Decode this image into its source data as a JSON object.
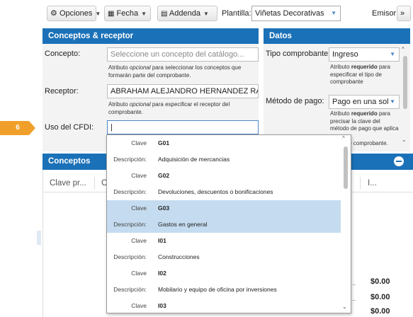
{
  "toolbar": {
    "opciones": "Opciones",
    "fecha": "Fecha",
    "addenda": "Addenda",
    "plantilla_label": "Plantilla:",
    "plantilla_value": "Viñetas Decorativas",
    "emisor": "Emisor",
    "more": "»"
  },
  "conceptos_receptor": {
    "title": "Conceptos & receptor",
    "concepto_label": "Concepto:",
    "concepto_placeholder": "Seleccione un concepto del catálogo...",
    "concepto_help_a": "Atributo",
    "concepto_help_em": "opcional",
    "concepto_help_b": "para seleccionar los conceptos que formarán parte del comprobante.",
    "receptor_label": "Receptor:",
    "receptor_value": "ABRAHAM ALEJANDRO HERNANDEZ RAMIR",
    "receptor_help_a": "Atributo",
    "receptor_help_em": "opcional",
    "receptor_help_b": "para especificar el receptor del comprobante.",
    "uso_label": "Uso del CFDI:",
    "uso_value": "|"
  },
  "datos": {
    "title": "Datos",
    "tipo_label": "Tipo comprobante:",
    "tipo_value": "Ingreso",
    "tipo_help_a": "Atributo",
    "tipo_help_b": "requerido",
    "tipo_help_c": "para especificar el tipo de comprobante",
    "metodo_label": "Método de pago:",
    "metodo_value": "Pago en una sol",
    "metodo_help_a": "Atributo",
    "metodo_help_b": "requerido",
    "metodo_help_c": "para precisar la clave del método de pago que aplica",
    "metodo_help_d": "te comprobante."
  },
  "step": {
    "number": "6"
  },
  "conceptos": {
    "title": "Conceptos",
    "col1": "Clave pr...",
    "col2": "C",
    "col3": "I...",
    "totals": [
      "$0.00",
      "$0.00",
      "$0.00"
    ]
  },
  "dropdown": {
    "clave_label": "Clave",
    "desc_label": "Descripción:",
    "items": [
      {
        "code": "G01",
        "desc": "Adquisición de mercancias"
      },
      {
        "code": "G02",
        "desc": "Devoluciones, descuentos o bonificaciones"
      },
      {
        "code": "G03",
        "desc": "Gastos en general"
      },
      {
        "code": "I01",
        "desc": "Construcciones"
      },
      {
        "code": "I02",
        "desc": "Mobilario y equipo de oficina por inversiones"
      },
      {
        "code": "I03",
        "desc": ""
      }
    ],
    "selected_code": "G03"
  },
  "colors": {
    "header_blue": "#1b71b8",
    "step_orange": "#f0a02a",
    "selected_bg": "#c5dcf0"
  }
}
